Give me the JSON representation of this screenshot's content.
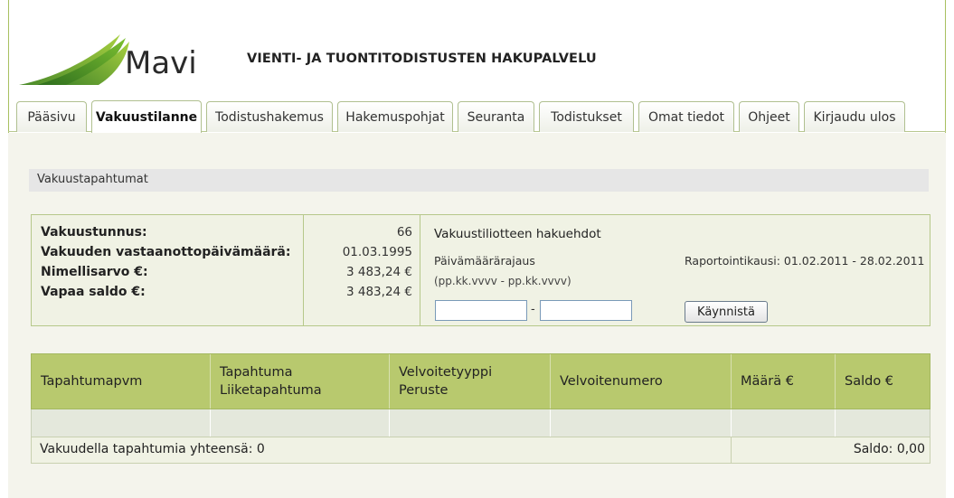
{
  "header": {
    "logo_text": "Mavi",
    "app_title": "VIENTI- JA TUONTITODISTUSTEN HAKUPALVELU"
  },
  "tabs": [
    {
      "label": "Pääsivu"
    },
    {
      "label": "Vakuustilanne"
    },
    {
      "label": "Todistushakemus"
    },
    {
      "label": "Hakemuspohjat"
    },
    {
      "label": "Seuranta"
    },
    {
      "label": "Todistukset"
    },
    {
      "label": "Omat tiedot"
    },
    {
      "label": "Ohjeet"
    },
    {
      "label": "Kirjaudu ulos"
    }
  ],
  "active_tab": "Vakuustilanne",
  "section_title": "Vakuustapahtumat",
  "info": {
    "rows": [
      {
        "label": "Vakuustunnus:",
        "value": "66"
      },
      {
        "label": "Vakuuden vastaanottopäivämäärä:",
        "value": "01.03.1995"
      },
      {
        "label": "Nimellisarvo €:",
        "value": "3 483,24 €"
      },
      {
        "label": "Vapaa saldo €:",
        "value": "3 483,24 €"
      }
    ]
  },
  "search": {
    "title": "Vakuustiliotteen hakuehdot",
    "date_label": "Päivämäärärajaus",
    "date_hint": "(pp.kk.vvvv - pp.kk.vvvv)",
    "report_period": "Raportointikausi: 01.02.2011 - 28.02.2011",
    "start_value": "",
    "end_value": "",
    "dash": "-",
    "button_label": "Käynnistä"
  },
  "table": {
    "headers": [
      {
        "line1": "Tapahtumapvm",
        "line2": ""
      },
      {
        "line1": "Tapahtuma",
        "line2": "Liiketapahtuma"
      },
      {
        "line1": "Velvoitetyyppi",
        "line2": "Peruste"
      },
      {
        "line1": "Velvoitenumero",
        "line2": ""
      },
      {
        "line1": "Määrä €",
        "line2": ""
      },
      {
        "line1": "Saldo €",
        "line2": ""
      }
    ],
    "footer_left": "Vakuudella tapahtumia yhteensä: 0",
    "footer_right": "Saldo: 0,00"
  },
  "colors": {
    "accent_green": "#b8c96e",
    "panel_bg": "#f0f2e4",
    "border_green": "#b6c88a"
  }
}
